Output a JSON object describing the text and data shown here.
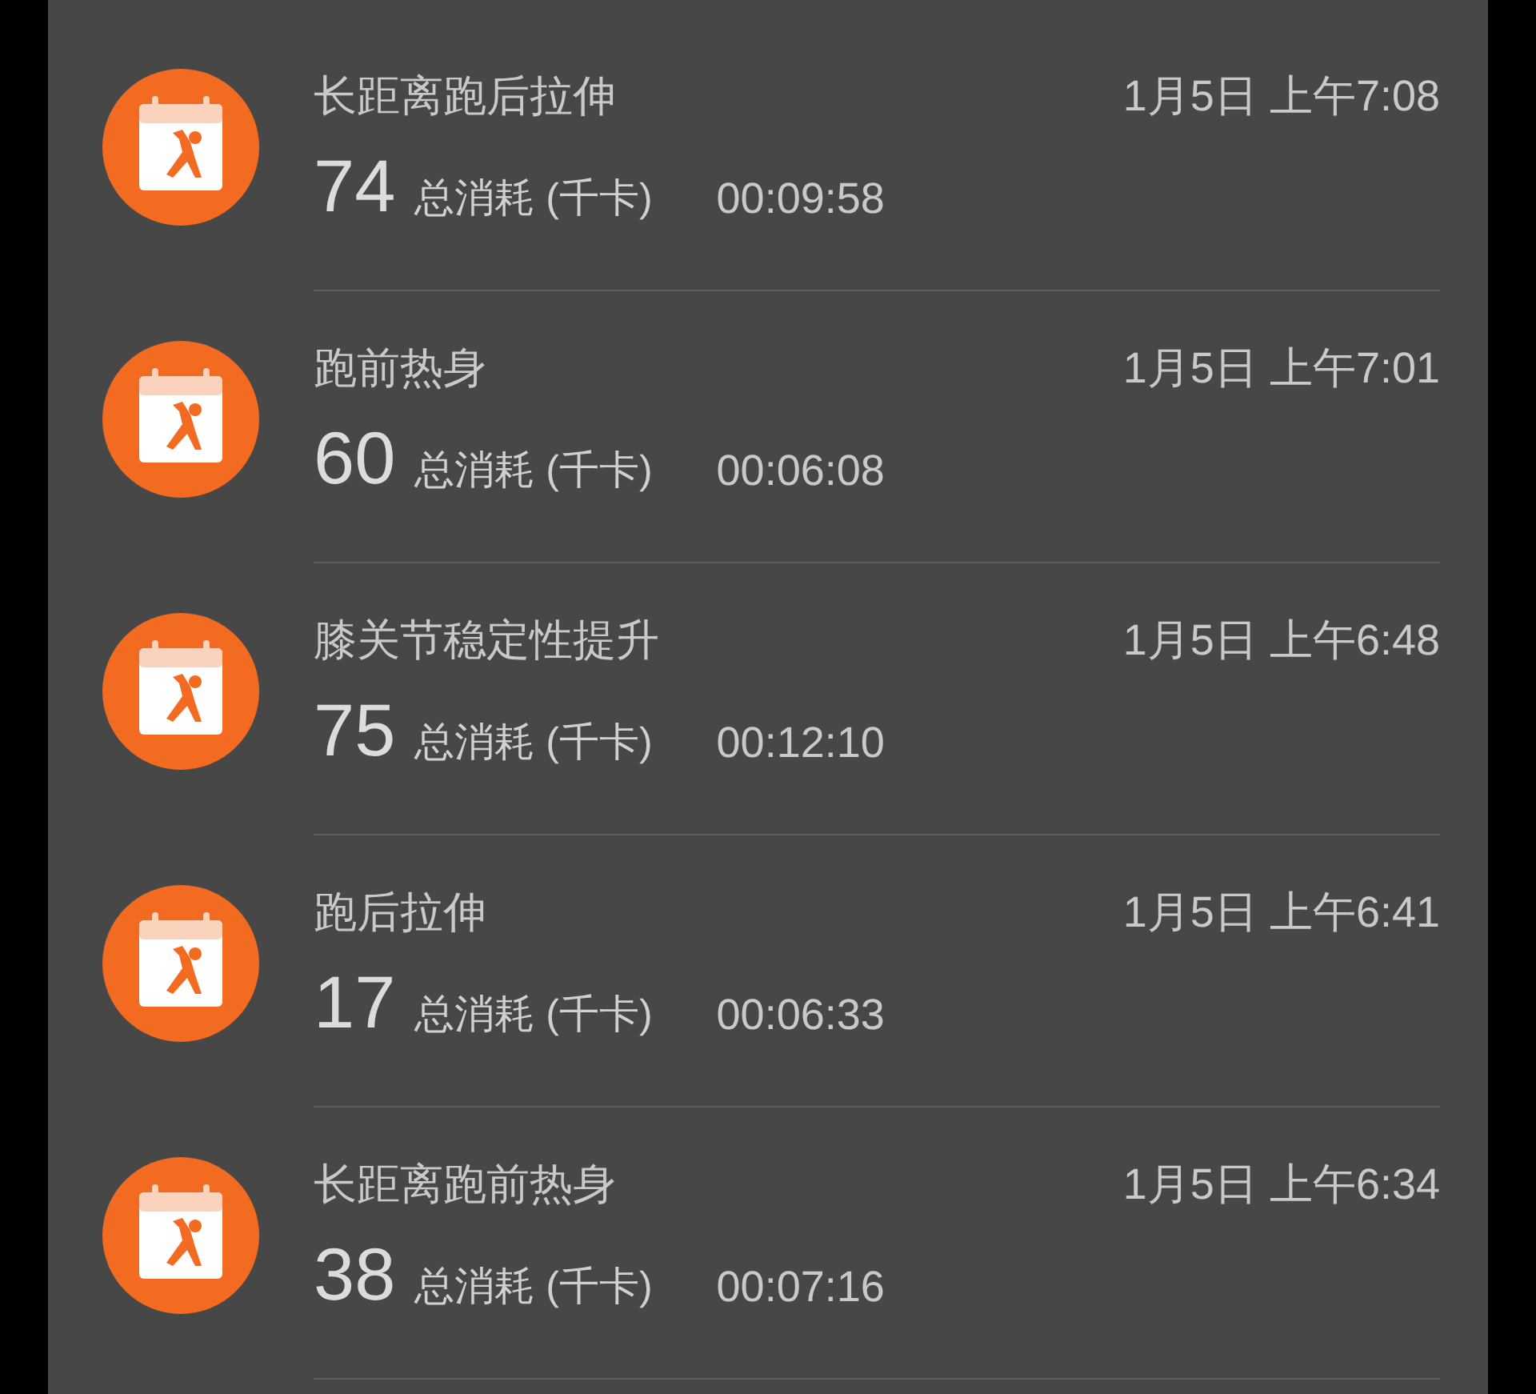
{
  "workouts": [
    {
      "name": "长距离跑后拉伸",
      "calories": "74",
      "unit": "总消耗 (千卡)",
      "duration": "00:09:58",
      "time": "1月5日 上午7:08"
    },
    {
      "name": "跑前热身",
      "calories": "60",
      "unit": "总消耗 (千卡)",
      "duration": "00:06:08",
      "time": "1月5日 上午7:01"
    },
    {
      "name": "膝关节稳定性提升",
      "calories": "75",
      "unit": "总消耗 (千卡)",
      "duration": "00:12:10",
      "time": "1月5日 上午6:48"
    },
    {
      "name": "跑后拉伸",
      "calories": "17",
      "unit": "总消耗 (千卡)",
      "duration": "00:06:33",
      "time": "1月5日 上午6:41"
    },
    {
      "name": "长距离跑前热身",
      "calories": "38",
      "unit": "总消耗 (千卡)",
      "duration": "00:07:16",
      "time": "1月5日 上午6:34"
    }
  ]
}
